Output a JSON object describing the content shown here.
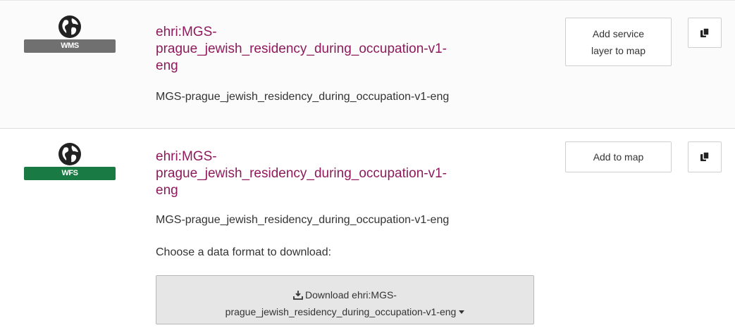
{
  "results": [
    {
      "service_badge": "WMS",
      "badge_color": "#707070",
      "icon": "globe-icon",
      "title": "ehri:MGS-prague_jewish_residency_during_occupation-v1-eng",
      "title_lines": [
        "ehri:MGS-",
        "prague_jewish_residency_during_occupation-v1-",
        "eng"
      ],
      "description": "MGS-prague_jewish_residency_during_occupation-v1-eng",
      "action_lines": [
        "Add service",
        "layer to map"
      ],
      "copy_icon": "copy-icon"
    },
    {
      "service_badge": "WFS",
      "badge_color": "#1a7a43",
      "icon": "globe-icon",
      "title": "ehri:MGS-prague_jewish_residency_during_occupation-v1-eng",
      "title_lines": [
        "ehri:MGS-",
        "prague_jewish_residency_during_occupation-v1-",
        "eng"
      ],
      "description": "MGS-prague_jewish_residency_during_occupation-v1-eng",
      "action_label": "Add to map",
      "copy_icon": "copy-icon",
      "choose_format_label": "Choose a data format to download:",
      "download_lines": [
        "Download ehri:MGS-",
        "prague_jewish_residency_during_occupation-v1-eng"
      ],
      "download_icon": "download-icon",
      "caret_icon": "caret-down-icon"
    }
  ],
  "colors": {
    "title_link": "#8e1a5c",
    "text": "#333333"
  }
}
